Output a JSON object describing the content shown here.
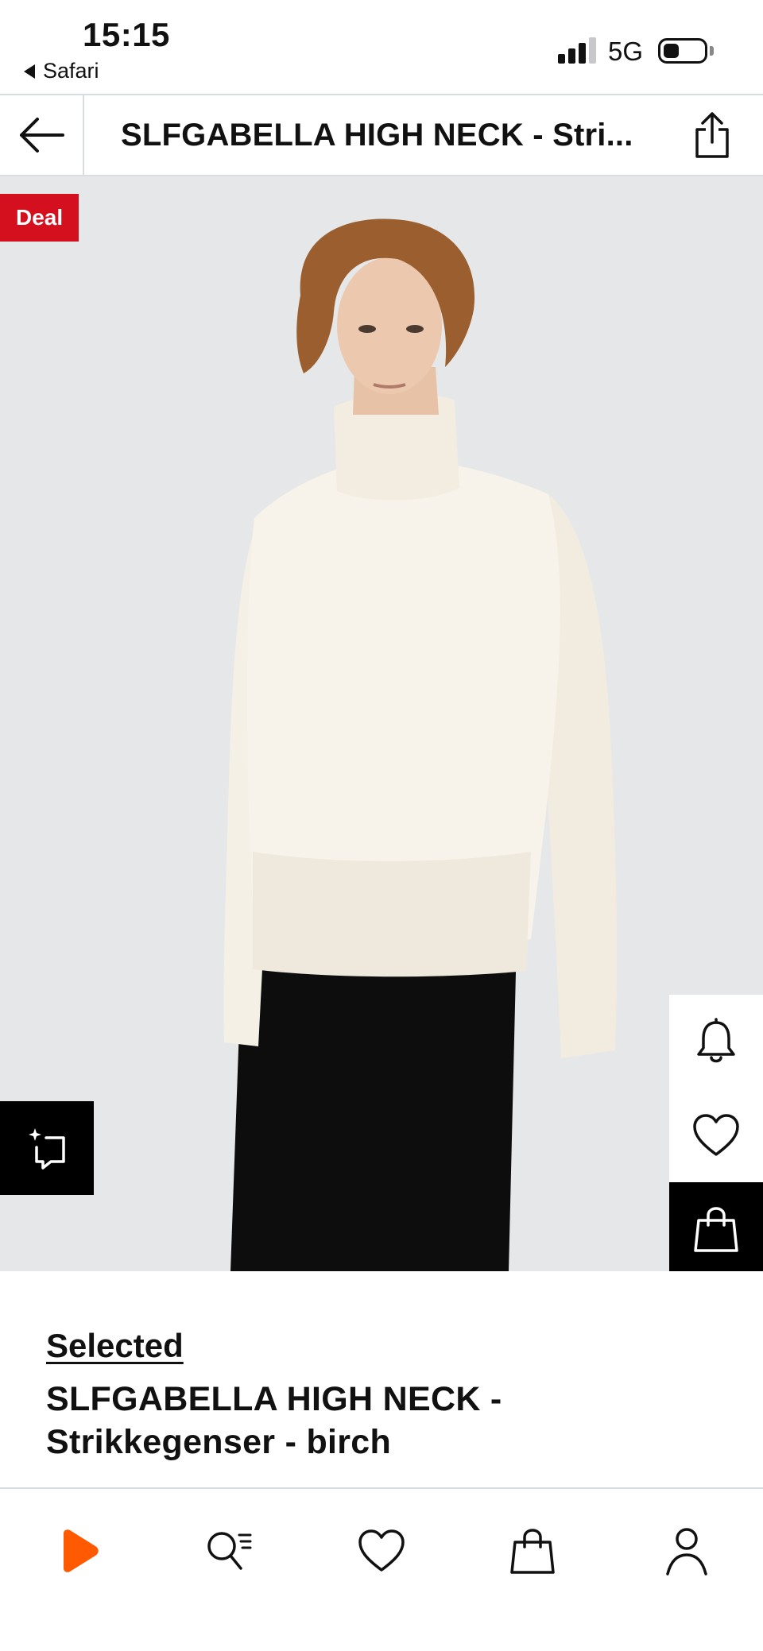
{
  "status_bar": {
    "time": "15:15",
    "back_app": "Safari",
    "network": "5G"
  },
  "header": {
    "title": "SLFGABELLA HIGH NECK - Stri..."
  },
  "product_image": {
    "badge": "Deal",
    "gallery_position": 0.25
  },
  "product": {
    "brand": "Selected",
    "name_line1": "SLFGABELLA HIGH NECK -",
    "name_line2": "Strikkegenser - birch"
  },
  "icons": {
    "back": "arrow-left-icon",
    "share": "share-icon",
    "similar": "similar-items-icon",
    "notify": "bell-icon",
    "wishlist": "heart-icon",
    "bag": "shopping-bag-icon",
    "tab_home": "play-logo-icon",
    "tab_search": "search-icon",
    "tab_wishlist": "heart-icon",
    "tab_bag": "shopping-bag-icon",
    "tab_account": "user-icon"
  },
  "colors": {
    "brand_orange": "#ff5a00",
    "deal_red": "#d4101e",
    "image_background": "#e6e7e9"
  }
}
